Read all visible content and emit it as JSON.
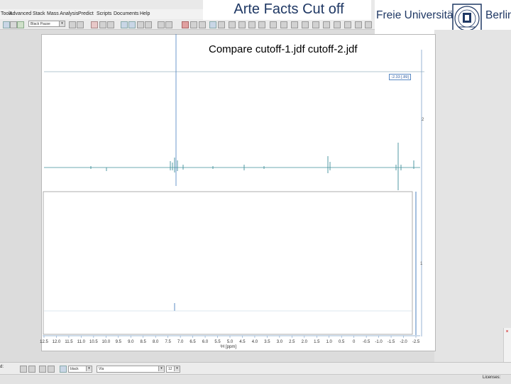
{
  "app": {
    "menu": [
      "Tools",
      "Advanced",
      "Stack",
      "Mass Analysis",
      "Predict",
      "Scripts",
      "Documents",
      "Help"
    ],
    "toolbar_combo": "Black Pause"
  },
  "slide": {
    "title": "Arte Facts Cut off",
    "logo_left": "Freie Universität",
    "logo_right": "Berlin"
  },
  "document": {
    "compare_text": "Compare  cutoff-1.jdf cutoff-2.jdf",
    "cursor_readout": "-2.33 [.89]",
    "axis_unit": "¹H [ppm]",
    "right_labels": [
      "2",
      "1"
    ],
    "x_ticks": [
      "12.5",
      "12.0",
      "11.5",
      "11.0",
      "10.5",
      "10.0",
      "9.5",
      "9.0",
      "8.5",
      "8.0",
      "7.5",
      "7.0",
      "6.5",
      "6.0",
      "5.5",
      "5.0",
      "4.5",
      "4.0",
      "3.5",
      "3.0",
      "2.5",
      "2.0",
      "1.5",
      "1.0",
      "0.5",
      "0",
      "-0.5",
      "-1.0",
      "-1.5",
      "-2.0",
      "-2.5"
    ]
  },
  "bottom_toolbar": {
    "dim_label": "d:",
    "color_combo": "black",
    "font_combo": "Vla",
    "size_combo": "12"
  },
  "status": {
    "licenses": "Licenses:"
  },
  "colors": {
    "title": "#1f3864",
    "spectrum_line": "#3f8f9a",
    "cursor": "#4a7fbf"
  }
}
